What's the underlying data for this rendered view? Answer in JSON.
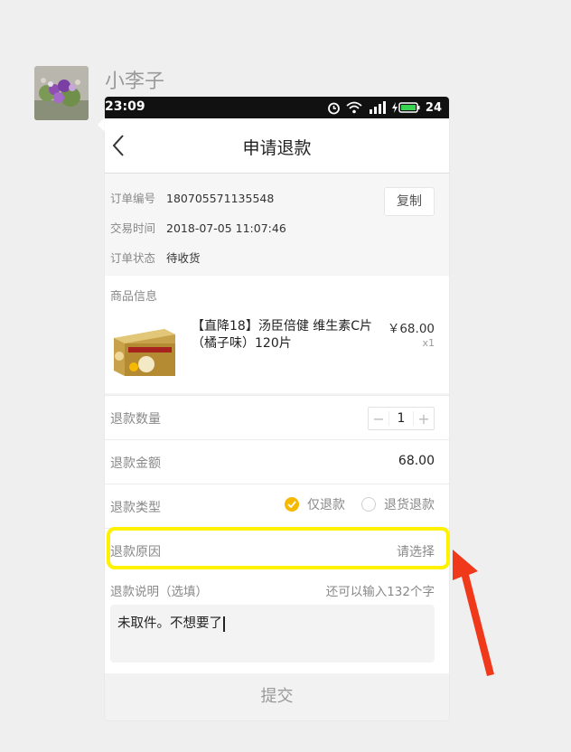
{
  "chat": {
    "username": "小李子"
  },
  "statusbar": {
    "time": "23:09",
    "battery": "24"
  },
  "header": {
    "title": "申请退款"
  },
  "order": {
    "number_label": "订单编号",
    "number": "180705571135548",
    "time_label": "交易时间",
    "time": "2018-07-05 11:07:46",
    "status_label": "订单状态",
    "status": "待收货",
    "copy_label": "复制"
  },
  "goods": {
    "section_title": "商品信息",
    "name": "【直降18】汤臣倍健 维生素C片（橘子味）120片",
    "price": "￥68.00",
    "qty": "x1"
  },
  "refund": {
    "qty_label": "退款数量",
    "qty": "1",
    "amount_label": "退款金额",
    "amount": "68.00",
    "type_label": "退款类型",
    "type_option_1": "仅退款",
    "type_option_2": "退货退款",
    "reason_label": "退款原因",
    "reason_placeholder": "请选择",
    "note_label": "退款说明（选填）",
    "note_counter": "还可以输入132个字",
    "note_value": "未取件。不想要了",
    "submit_label": "提交"
  },
  "colors": {
    "accent": "#f6b800",
    "highlight": "#fff200",
    "arrow": "#f0391a"
  }
}
